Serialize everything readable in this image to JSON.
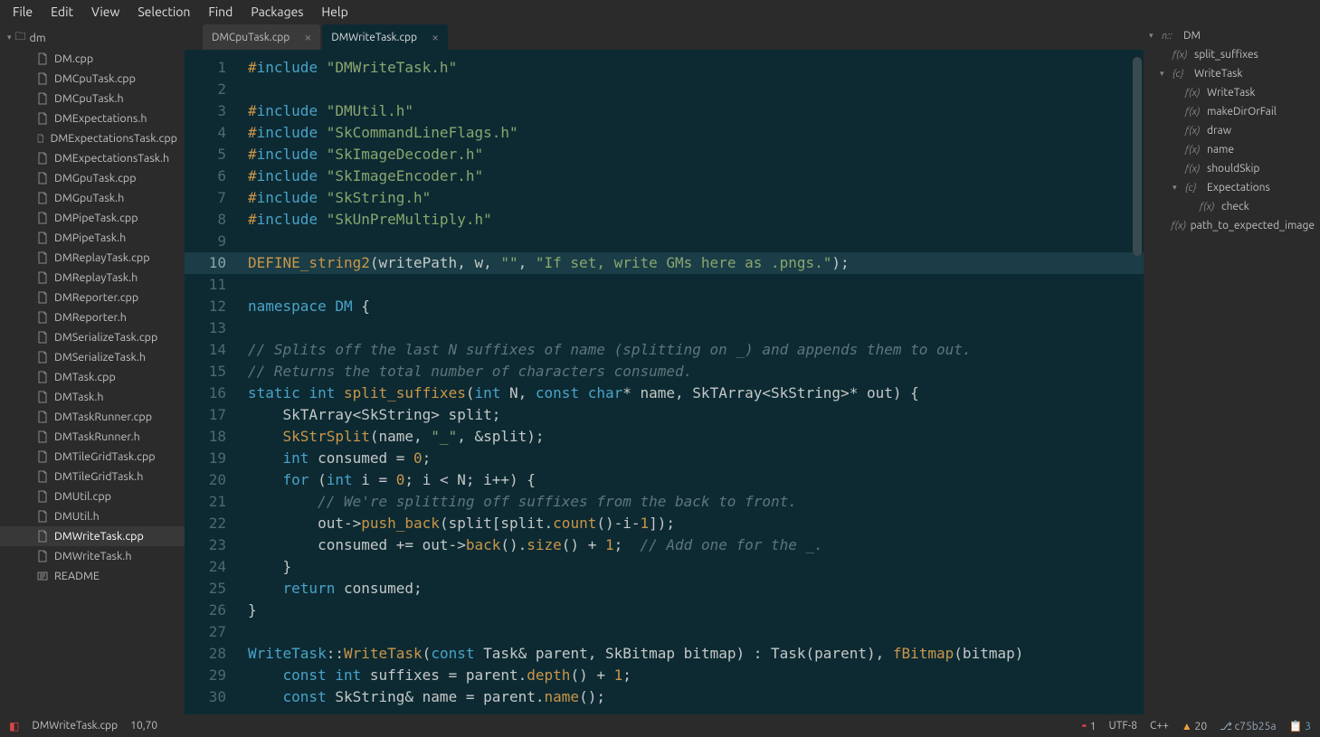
{
  "menu": [
    "File",
    "Edit",
    "View",
    "Selection",
    "Find",
    "Packages",
    "Help"
  ],
  "tree": {
    "root": "dm",
    "files": [
      "DM.cpp",
      "DMCpuTask.cpp",
      "DMCpuTask.h",
      "DMExpectations.h",
      "DMExpectationsTask.cpp",
      "DMExpectationsTask.h",
      "DMGpuTask.cpp",
      "DMGpuTask.h",
      "DMPipeTask.cpp",
      "DMPipeTask.h",
      "DMReplayTask.cpp",
      "DMReplayTask.h",
      "DMReporter.cpp",
      "DMReporter.h",
      "DMSerializeTask.cpp",
      "DMSerializeTask.h",
      "DMTask.cpp",
      "DMTask.h",
      "DMTaskRunner.cpp",
      "DMTaskRunner.h",
      "DMTileGridTask.cpp",
      "DMTileGridTask.h",
      "DMUtil.cpp",
      "DMUtil.h",
      "DMWriteTask.cpp",
      "DMWriteTask.h",
      "README"
    ],
    "active": "DMWriteTask.cpp"
  },
  "tabs": [
    {
      "label": "DMCpuTask.cpp",
      "active": false
    },
    {
      "label": "DMWriteTask.cpp",
      "active": true
    }
  ],
  "code": {
    "highlight_line": 10,
    "lines": [
      {
        "n": 1,
        "t": [
          [
            "pp",
            "#"
          ],
          [
            "kw",
            "include "
          ],
          [
            "str",
            "\"DMWriteTask.h\""
          ]
        ]
      },
      {
        "n": 2,
        "t": []
      },
      {
        "n": 3,
        "t": [
          [
            "pp",
            "#"
          ],
          [
            "kw",
            "include "
          ],
          [
            "str",
            "\"DMUtil.h\""
          ]
        ]
      },
      {
        "n": 4,
        "t": [
          [
            "pp",
            "#"
          ],
          [
            "kw",
            "include "
          ],
          [
            "str",
            "\"SkCommandLineFlags.h\""
          ]
        ]
      },
      {
        "n": 5,
        "t": [
          [
            "pp",
            "#"
          ],
          [
            "kw",
            "include "
          ],
          [
            "str",
            "\"SkImageDecoder.h\""
          ]
        ]
      },
      {
        "n": 6,
        "t": [
          [
            "pp",
            "#"
          ],
          [
            "kw",
            "include "
          ],
          [
            "str",
            "\"SkImageEncoder.h\""
          ]
        ]
      },
      {
        "n": 7,
        "t": [
          [
            "pp",
            "#"
          ],
          [
            "kw",
            "include "
          ],
          [
            "str",
            "\"SkString.h\""
          ]
        ]
      },
      {
        "n": 8,
        "t": [
          [
            "pp",
            "#"
          ],
          [
            "kw",
            "include "
          ],
          [
            "str",
            "\"SkUnPreMultiply.h\""
          ]
        ]
      },
      {
        "n": 9,
        "t": []
      },
      {
        "n": 10,
        "t": [
          [
            "fn",
            "DEFINE_string2"
          ],
          [
            "",
            "(writePath, w, "
          ],
          [
            "str",
            "\"\""
          ],
          [
            "",
            ", "
          ],
          [
            "str",
            "\"If set, write GMs here as .pngs.\""
          ],
          [
            "",
            ");"
          ]
        ]
      },
      {
        "n": 11,
        "t": []
      },
      {
        "n": 12,
        "t": [
          [
            "kw",
            "namespace "
          ],
          [
            "tp",
            "DM"
          ],
          [
            "",
            " {"
          ]
        ]
      },
      {
        "n": 13,
        "t": []
      },
      {
        "n": 14,
        "t": [
          [
            "cm",
            "// Splits off the last N suffixes of name (splitting on _) and appends them to out."
          ]
        ]
      },
      {
        "n": 15,
        "t": [
          [
            "cm",
            "// Returns the total number of characters consumed."
          ]
        ]
      },
      {
        "n": 16,
        "t": [
          [
            "kw",
            "static "
          ],
          [
            "tp",
            "int "
          ],
          [
            "fn",
            "split_suffixes"
          ],
          [
            "",
            "("
          ],
          [
            "tp",
            "int"
          ],
          [
            "",
            " N, "
          ],
          [
            "kw",
            "const "
          ],
          [
            "tp",
            "char"
          ],
          [
            "",
            "* name, SkTArray<SkString>* out) {"
          ]
        ]
      },
      {
        "n": 17,
        "t": [
          [
            "",
            "    SkTArray<SkString> split;"
          ]
        ]
      },
      {
        "n": 18,
        "t": [
          [
            "",
            "    "
          ],
          [
            "fn",
            "SkStrSplit"
          ],
          [
            "",
            "(name, "
          ],
          [
            "str",
            "\"_\""
          ],
          [
            "",
            ", &split);"
          ]
        ]
      },
      {
        "n": 19,
        "t": [
          [
            "",
            "    "
          ],
          [
            "tp",
            "int"
          ],
          [
            "",
            " consumed = "
          ],
          [
            "num",
            "0"
          ],
          [
            "",
            ";"
          ]
        ]
      },
      {
        "n": 20,
        "t": [
          [
            "",
            "    "
          ],
          [
            "kw",
            "for"
          ],
          [
            "",
            " ("
          ],
          [
            "tp",
            "int"
          ],
          [
            "",
            " i = "
          ],
          [
            "num",
            "0"
          ],
          [
            "",
            "; i < N; i++) {"
          ]
        ]
      },
      {
        "n": 21,
        "t": [
          [
            "",
            "        "
          ],
          [
            "cm",
            "// We're splitting off suffixes from the back to front."
          ]
        ]
      },
      {
        "n": 22,
        "t": [
          [
            "",
            "        out->"
          ],
          [
            "fn",
            "push_back"
          ],
          [
            "",
            "(split[split."
          ],
          [
            "fn",
            "count"
          ],
          [
            "",
            "()-i-"
          ],
          [
            "num",
            "1"
          ],
          [
            "",
            "]);"
          ]
        ]
      },
      {
        "n": 23,
        "t": [
          [
            "",
            "        consumed += out->"
          ],
          [
            "fn",
            "back"
          ],
          [
            "",
            "()."
          ],
          [
            "fn",
            "size"
          ],
          [
            "",
            "() + "
          ],
          [
            "num",
            "1"
          ],
          [
            "",
            ";  "
          ],
          [
            "cm",
            "// Add one for the _."
          ]
        ]
      },
      {
        "n": 24,
        "t": [
          [
            "",
            "    }"
          ]
        ]
      },
      {
        "n": 25,
        "t": [
          [
            "",
            "    "
          ],
          [
            "kw",
            "return"
          ],
          [
            "",
            " consumed;"
          ]
        ]
      },
      {
        "n": 26,
        "t": [
          [
            "",
            "}"
          ]
        ]
      },
      {
        "n": 27,
        "t": []
      },
      {
        "n": 28,
        "t": [
          [
            "tp",
            "WriteTask"
          ],
          [
            "",
            "::"
          ],
          [
            "fn",
            "WriteTask"
          ],
          [
            "",
            "("
          ],
          [
            "kw",
            "const"
          ],
          [
            "",
            " Task& parent, SkBitmap bitmap) : Task(parent), "
          ],
          [
            "fn",
            "fBitmap"
          ],
          [
            "",
            "(bitmap)"
          ]
        ]
      },
      {
        "n": 29,
        "t": [
          [
            "",
            "    "
          ],
          [
            "kw",
            "const "
          ],
          [
            "tp",
            "int"
          ],
          [
            "",
            " suffixes = parent."
          ],
          [
            "fn",
            "depth"
          ],
          [
            "",
            "() + "
          ],
          [
            "num",
            "1"
          ],
          [
            "",
            ";"
          ]
        ]
      },
      {
        "n": 30,
        "t": [
          [
            "",
            "    "
          ],
          [
            "kw",
            "const"
          ],
          [
            "",
            " SkString& name = parent."
          ],
          [
            "fn",
            "name"
          ],
          [
            "",
            "();"
          ]
        ]
      }
    ]
  },
  "outline": [
    {
      "caret": "▾",
      "sym": "n::",
      "label": "DM",
      "indent": 0
    },
    {
      "caret": "",
      "sym": "f(x)",
      "label": "split_suffixes",
      "indent": 1
    },
    {
      "caret": "▾",
      "sym": "{c}",
      "label": "WriteTask",
      "indent": 1
    },
    {
      "caret": "",
      "sym": "f(x)",
      "label": "WriteTask",
      "indent": 2
    },
    {
      "caret": "",
      "sym": "f(x)",
      "label": "makeDirOrFail",
      "indent": 2
    },
    {
      "caret": "",
      "sym": "f(x)",
      "label": "draw",
      "indent": 2
    },
    {
      "caret": "",
      "sym": "f(x)",
      "label": "name",
      "indent": 2
    },
    {
      "caret": "",
      "sym": "f(x)",
      "label": "shouldSkip",
      "indent": 2
    },
    {
      "caret": "▾",
      "sym": "{c}",
      "label": "Expectations",
      "indent": 2
    },
    {
      "caret": "",
      "sym": "f(x)",
      "label": "check",
      "indent": 3
    },
    {
      "caret": "",
      "sym": "f(x)",
      "label": "path_to_expected_image",
      "indent": 1
    }
  ],
  "status": {
    "file": "DMWriteTask.cpp",
    "pos": "10,70",
    "errors": "1",
    "encoding": "UTF-8",
    "lang": "C++",
    "warnings": "20",
    "branch": "c75b25a",
    "clip": "3"
  }
}
